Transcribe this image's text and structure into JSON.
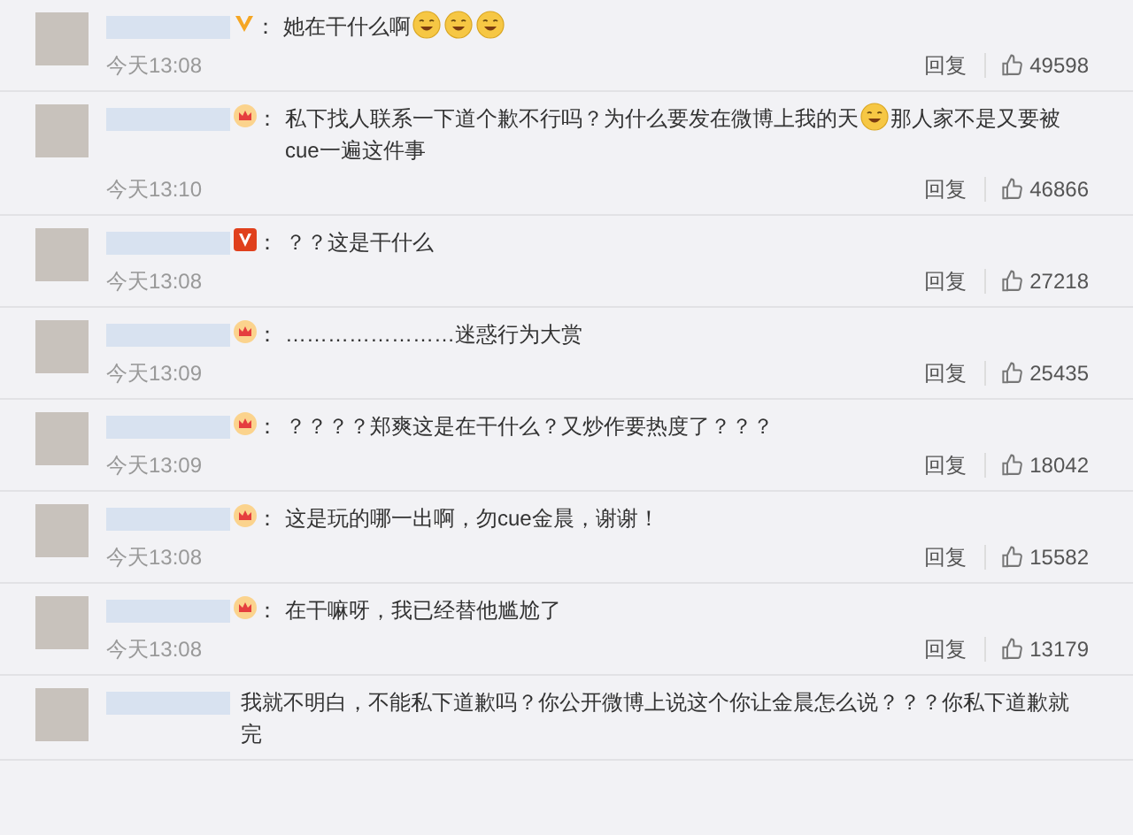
{
  "comments": [
    {
      "kind": "v_plain",
      "colon": "：",
      "parts": [
        {
          "kind": "text",
          "text": "她在干什么啊"
        },
        {
          "kind": "emoji"
        },
        {
          "kind": "emoji"
        },
        {
          "kind": "emoji"
        }
      ],
      "time": "今天13:08",
      "reply": "回复",
      "likes": "49598"
    },
    {
      "kind": "crown",
      "colon": "：",
      "parts": [
        {
          "kind": "text",
          "text": "私下找人联系一下道个歉不行吗？为什么要发在微博上我的天"
        },
        {
          "kind": "emoji"
        },
        {
          "kind": "text",
          "text": "那人家不是又要被cue一遍这件事"
        }
      ],
      "time": "今天13:10",
      "reply": "回复",
      "likes": "46866"
    },
    {
      "kind": "v_box",
      "colon": "：",
      "parts": [
        {
          "kind": "text",
          "text": "？？这是干什么"
        }
      ],
      "time": "今天13:08",
      "reply": "回复",
      "likes": "27218"
    },
    {
      "kind": "crown",
      "colon": "：",
      "parts": [
        {
          "kind": "text",
          "text": "……………………迷惑行为大赏"
        }
      ],
      "time": "今天13:09",
      "reply": "回复",
      "likes": "25435"
    },
    {
      "kind": "crown",
      "colon": "：",
      "parts": [
        {
          "kind": "text",
          "text": "？？？？郑爽这是在干什么？又炒作要热度了？？？"
        }
      ],
      "time": "今天13:09",
      "reply": "回复",
      "likes": "18042"
    },
    {
      "kind": "crown",
      "colon": "：",
      "parts": [
        {
          "kind": "text",
          "text": "这是玩的哪一出啊，勿cue金晨，谢谢！"
        }
      ],
      "time": "今天13:08",
      "reply": "回复",
      "likes": "15582"
    },
    {
      "kind": "crown",
      "colon": "：",
      "parts": [
        {
          "kind": "text",
          "text": "在干嘛呀，我已经替他尴尬了"
        }
      ],
      "time": "今天13:08",
      "reply": "回复",
      "likes": "13179"
    },
    {
      "kind": "plain",
      "parts": [
        {
          "kind": "text",
          "text": "我就不明白，不能私下道歉吗？你公开微博上说这个你让金晨怎么说？？？你私下道歉就完"
        }
      ]
    }
  ]
}
